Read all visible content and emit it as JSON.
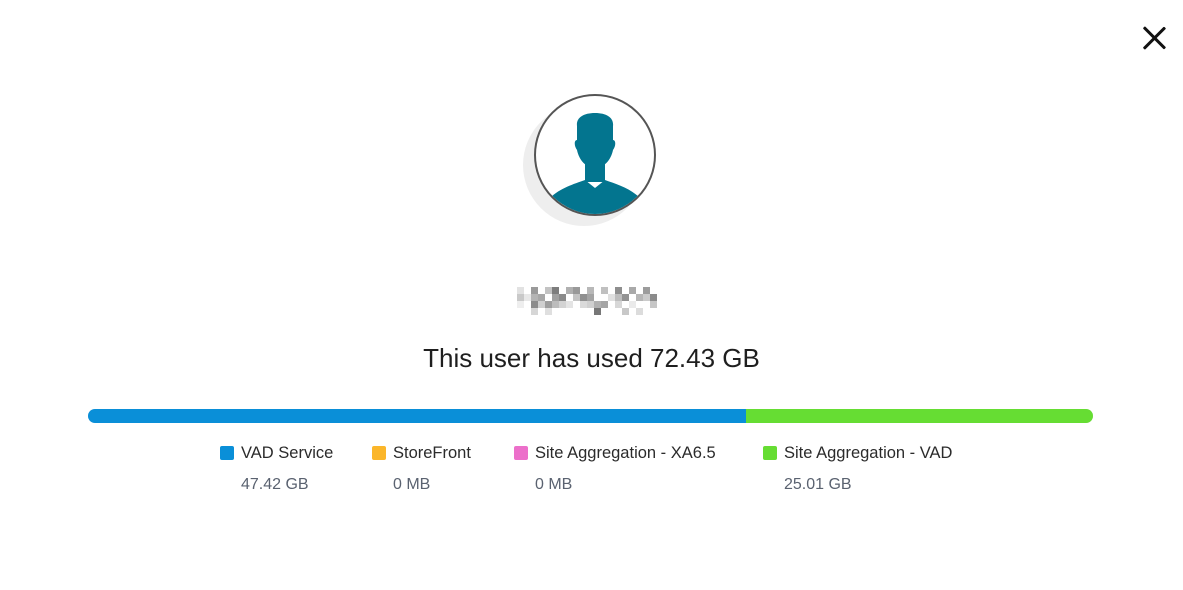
{
  "dialog": {
    "close_icon": "close-icon"
  },
  "user": {
    "avatar_icon": "user-silhouette-icon",
    "avatar_color": "#03758f"
  },
  "usage": {
    "summary": "This user has used 72.43 GB"
  },
  "bar": {
    "segments": [
      {
        "name": "VAD Service",
        "fraction": 0.6547,
        "color": "#0a8fd8"
      },
      {
        "name": "StoreFront",
        "fraction": 0.0,
        "color": "#fbb62a"
      },
      {
        "name": "Site Aggregation - XA6.5",
        "fraction": 0.0,
        "color": "#ec6fca"
      },
      {
        "name": "Site Aggregation - VAD",
        "fraction": 0.3453,
        "color": "#66dd33"
      }
    ]
  },
  "legend": {
    "items": [
      {
        "label": "VAD Service",
        "value": "47.42 GB",
        "color": "#0a8fd8"
      },
      {
        "label": "StoreFront",
        "value": "0 MB",
        "color": "#fbb62a"
      },
      {
        "label": "Site Aggregation - XA6.5",
        "value": "0 MB",
        "color": "#ec6fca"
      },
      {
        "label": "Site Aggregation - VAD",
        "value": "25.01 GB",
        "color": "#66dd33"
      }
    ]
  }
}
